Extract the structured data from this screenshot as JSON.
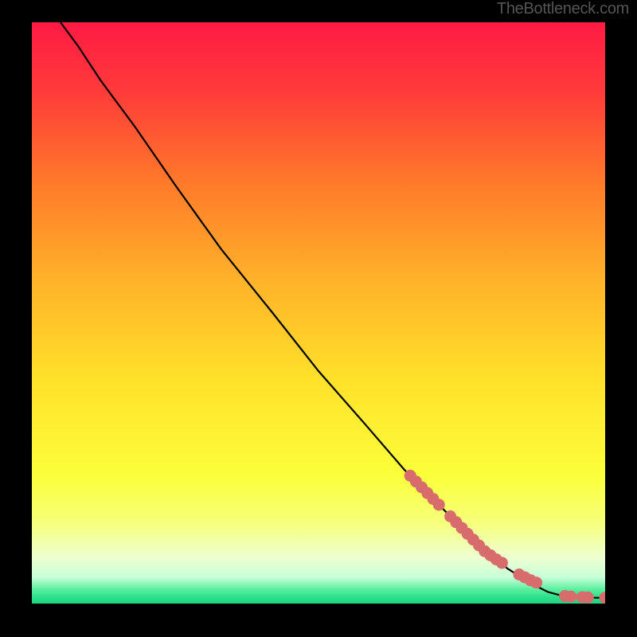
{
  "attribution": "TheBottleneck.com",
  "chart_data": {
    "type": "line",
    "title": "",
    "xlabel": "",
    "ylabel": "",
    "xlim": [
      0,
      100
    ],
    "ylim": [
      0,
      100
    ],
    "background_gradient": {
      "stops": [
        {
          "offset": 0.0,
          "color": "#ff1a44"
        },
        {
          "offset": 0.12,
          "color": "#ff3b3b"
        },
        {
          "offset": 0.28,
          "color": "#ff7b2a"
        },
        {
          "offset": 0.45,
          "color": "#ffb42a"
        },
        {
          "offset": 0.62,
          "color": "#ffe22a"
        },
        {
          "offset": 0.78,
          "color": "#fbff3a"
        },
        {
          "offset": 0.86,
          "color": "#f6ff7a"
        },
        {
          "offset": 0.92,
          "color": "#eeffd0"
        },
        {
          "offset": 0.955,
          "color": "#c8ffd8"
        },
        {
          "offset": 0.975,
          "color": "#5ef0a0"
        },
        {
          "offset": 0.99,
          "color": "#2adf8a"
        },
        {
          "offset": 1.0,
          "color": "#1fd67f"
        }
      ]
    },
    "series": [
      {
        "name": "bottleneck-curve",
        "type": "line",
        "x": [
          5,
          8,
          12,
          18,
          25,
          33,
          42,
          50,
          58,
          65,
          72,
          78,
          83,
          87,
          90,
          93,
          96,
          100
        ],
        "y": [
          100,
          96,
          90,
          82,
          72,
          61,
          50,
          40,
          31,
          23,
          16,
          10,
          6,
          3.5,
          2,
          1.2,
          1,
          1
        ]
      },
      {
        "name": "highlighted-points",
        "type": "scatter",
        "color": "#d86c6c",
        "x": [
          66,
          67,
          68,
          69,
          70,
          71,
          73,
          74,
          75,
          76,
          77,
          78,
          79,
          80,
          81,
          82,
          85,
          86,
          87,
          88,
          93,
          94,
          96,
          97,
          100
        ],
        "y": [
          22,
          21,
          20,
          19,
          18,
          17,
          15,
          14,
          13,
          12,
          11,
          10,
          9,
          8.3,
          7.6,
          7,
          5,
          4.5,
          4,
          3.6,
          1.3,
          1.2,
          1.1,
          1.05,
          1
        ]
      }
    ]
  }
}
